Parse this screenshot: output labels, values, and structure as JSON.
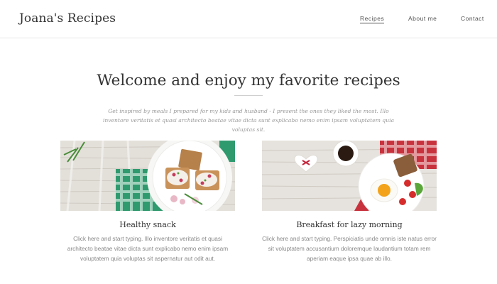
{
  "site": {
    "title": "Joana's Recipes"
  },
  "nav": {
    "items": [
      {
        "label": "Recipes",
        "active": true
      },
      {
        "label": "About me",
        "active": false
      },
      {
        "label": "Contact",
        "active": false
      }
    ]
  },
  "hero": {
    "title": "Welcome and enjoy my favorite recipes",
    "intro": "Get inspired by meals I prepared for my kids and husband - I present the ones they liked the most. Illo inventore veritatis et quasi architecto beatae vitae dicta sunt explicabo nemo enim ipsam voluptatem quia voluptas sit."
  },
  "cards": [
    {
      "title": "Healthy snack",
      "text": "Click here and start typing. Illo inventore veritatis et quasi architecto beatae vitae dicta sunt explicabo nemo enim ipsam voluptatem quia voluptas sit aspernatur aut odit aut."
    },
    {
      "title": "Breakfast for lazy morning",
      "text": "Click here and start typing. Perspiciatis unde omnis iste natus error sit voluptatem accusantium doloremque laudantium totam rem aperiam eaque ipsa quae ab illo."
    }
  ],
  "colors": {
    "text": "#333333",
    "muted": "#888888",
    "divider": "#e6e6e6",
    "wood": "#e9e6e0"
  }
}
